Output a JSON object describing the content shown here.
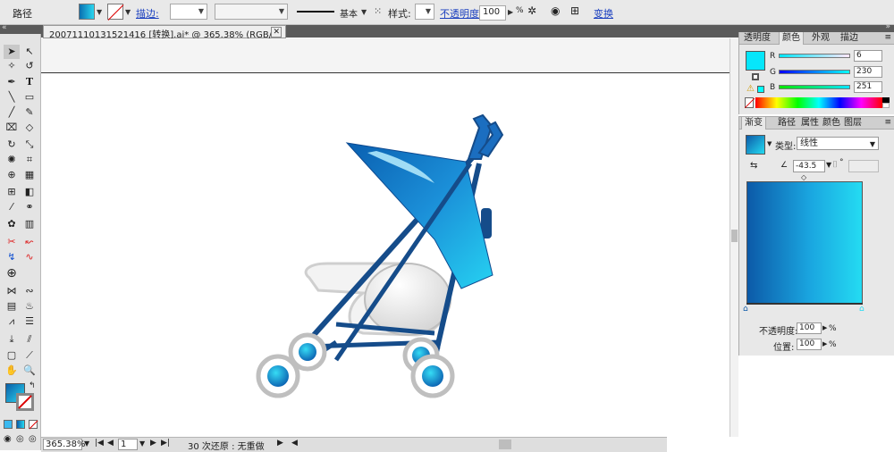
{
  "control_bar": {
    "object_type": "路径",
    "stroke_label": "描边:",
    "brush_label": "基本",
    "style_label": "样式:",
    "opacity_label": "不透明度:",
    "opacity_value": "100",
    "opacity_unit": "%",
    "transform_link": "变换"
  },
  "document": {
    "tab_title": "20071110131521416 [转换].ai* @ 365.38% (RGB/预览)",
    "close_glyph": "✕"
  },
  "status_bar": {
    "zoom": "365.38%",
    "page": "1",
    "undo_text": "30 次还原 : 无重做"
  },
  "color_panel": {
    "tabs": [
      "透明度",
      "颜色",
      "外观",
      "描边"
    ],
    "active_tab": "颜色",
    "channels": [
      {
        "name": "R",
        "value": "6"
      },
      {
        "name": "G",
        "value": "230"
      },
      {
        "name": "B",
        "value": "251"
      }
    ],
    "swatch_color": "#06E6FB"
  },
  "gradient_panel": {
    "tabs": [
      "渐变",
      "路径",
      "属性",
      "颜色",
      "图层"
    ],
    "active_tab": "渐变",
    "type_label": "类型:",
    "type_value": "线性",
    "angle_value": "-43.5",
    "angle_unit": "°",
    "opacity_label": "不透明度:",
    "opacity_value": "100",
    "opacity_unit": "%",
    "location_label": "位置:",
    "location_value": "100",
    "location_unit": "%",
    "start_color": "#0C5AA8",
    "end_color": "#24DBF2"
  },
  "tools": {
    "type_tool": "T"
  }
}
